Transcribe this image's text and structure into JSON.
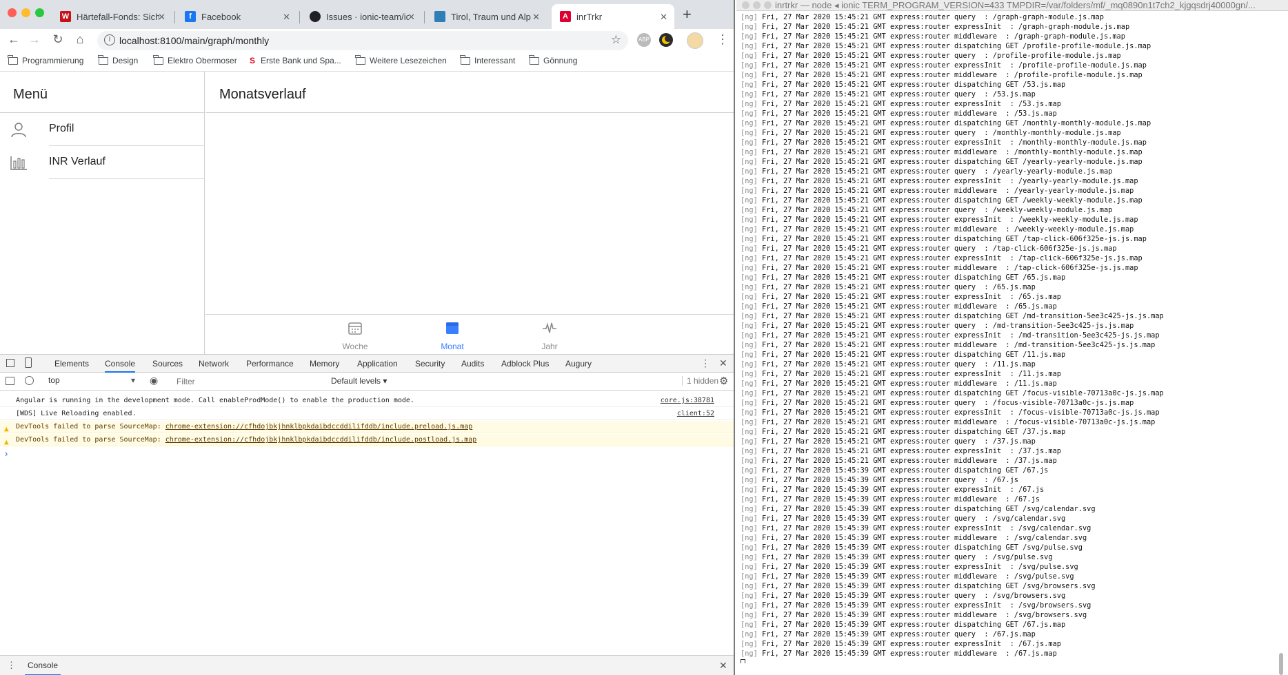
{
  "browser": {
    "tabs": [
      {
        "title": "Härtefall-Fonds: Siche",
        "favicon": "W",
        "favicon_bg": "#c4121a",
        "favicon_color": "#ffffff"
      },
      {
        "title": "Facebook",
        "favicon": "f",
        "favicon_bg": "#1877f2",
        "favicon_color": "#ffffff"
      },
      {
        "title": "Issues · ionic-team/io",
        "favicon": "github-icon",
        "favicon_bg": "#202124",
        "favicon_color": "#ffffff"
      },
      {
        "title": "Tirol, Traum und Alp",
        "favicon": "leaf-icon",
        "favicon_bg": "#2e7fb8",
        "favicon_color": "#ffffff"
      },
      {
        "title": "inrTrkr",
        "favicon": "A",
        "favicon_bg": "#dd0031",
        "favicon_color": "#ffffff"
      }
    ],
    "url": "localhost:8100/main/graph/monthly",
    "bookmarks": [
      "Programmierung",
      "Design",
      "Elektro Obermoser",
      "Erste Bank und Spa...",
      "Weitere Lesezeichen",
      "Interessant",
      "Gönnung"
    ],
    "ext_abp": "ABP"
  },
  "app": {
    "menu_title": "Menü",
    "menu_items": [
      {
        "label": "Profil",
        "icon": "person-icon"
      },
      {
        "label": "INR Verlauf",
        "icon": "bar-chart-icon"
      }
    ],
    "page_title": "Monatsverlauf",
    "tabs": [
      {
        "label": "Woche",
        "icon": "calendar-icon"
      },
      {
        "label": "Monat",
        "icon": "calendar-icon",
        "selected": true
      },
      {
        "label": "Jahr",
        "icon": "pulse-icon"
      }
    ],
    "accent": "#3880ff"
  },
  "devtools": {
    "tabs": [
      "Elements",
      "Console",
      "Sources",
      "Network",
      "Performance",
      "Memory",
      "Application",
      "Security",
      "Audits",
      "Adblock Plus",
      "Augury"
    ],
    "context": "top",
    "filter_placeholder": "Filter",
    "levels": "Default levels",
    "hidden": "1 hidden",
    "messages": [
      {
        "text": "Angular is running in the development mode. Call enableProdMode() to enable the production mode.",
        "source": "core.js:38781",
        "level": "info"
      },
      {
        "text": "[WDS] Live Reloading enabled.",
        "source": "client:52",
        "level": "info"
      },
      {
        "text": "DevTools failed to parse SourceMap: ",
        "link": "chrome-extension://cfhdojbkjhnklbpkdaibdccddilifddb/include.preload.js.map",
        "level": "warn"
      },
      {
        "text": "DevTools failed to parse SourceMap: ",
        "link": "chrome-extension://cfhdojbkjhnklbpkdaibdccddilifddb/include.postload.js.map",
        "level": "warn"
      }
    ],
    "prompt": "›",
    "drawer_tab": "Console"
  },
  "terminal": {
    "title": "inrtrkr — node ◂ ionic TERM_PROGRAM_VERSION=433 TMPDIR=/var/folders/mf/_mq0890n1t7ch2_kjgqsdrj40000gn/...",
    "prefix": "[ng]",
    "lines": [
      "Fri, 27 Mar 2020 15:45:21 GMT express:router query  : /graph-graph-module.js.map",
      "Fri, 27 Mar 2020 15:45:21 GMT express:router expressInit  : /graph-graph-module.js.map",
      "Fri, 27 Mar 2020 15:45:21 GMT express:router middleware  : /graph-graph-module.js.map",
      "Fri, 27 Mar 2020 15:45:21 GMT express:router dispatching GET /profile-profile-module.js.map",
      "Fri, 27 Mar 2020 15:45:21 GMT express:router query  : /profile-profile-module.js.map",
      "Fri, 27 Mar 2020 15:45:21 GMT express:router expressInit  : /profile-profile-module.js.map",
      "Fri, 27 Mar 2020 15:45:21 GMT express:router middleware  : /profile-profile-module.js.map",
      "Fri, 27 Mar 2020 15:45:21 GMT express:router dispatching GET /53.js.map",
      "Fri, 27 Mar 2020 15:45:21 GMT express:router query  : /53.js.map",
      "Fri, 27 Mar 2020 15:45:21 GMT express:router expressInit  : /53.js.map",
      "Fri, 27 Mar 2020 15:45:21 GMT express:router middleware  : /53.js.map",
      "Fri, 27 Mar 2020 15:45:21 GMT express:router dispatching GET /monthly-monthly-module.js.map",
      "Fri, 27 Mar 2020 15:45:21 GMT express:router query  : /monthly-monthly-module.js.map",
      "Fri, 27 Mar 2020 15:45:21 GMT express:router expressInit  : /monthly-monthly-module.js.map",
      "Fri, 27 Mar 2020 15:45:21 GMT express:router middleware  : /monthly-monthly-module.js.map",
      "Fri, 27 Mar 2020 15:45:21 GMT express:router dispatching GET /yearly-yearly-module.js.map",
      "Fri, 27 Mar 2020 15:45:21 GMT express:router query  : /yearly-yearly-module.js.map",
      "Fri, 27 Mar 2020 15:45:21 GMT express:router expressInit  : /yearly-yearly-module.js.map",
      "Fri, 27 Mar 2020 15:45:21 GMT express:router middleware  : /yearly-yearly-module.js.map",
      "Fri, 27 Mar 2020 15:45:21 GMT express:router dispatching GET /weekly-weekly-module.js.map",
      "Fri, 27 Mar 2020 15:45:21 GMT express:router query  : /weekly-weekly-module.js.map",
      "Fri, 27 Mar 2020 15:45:21 GMT express:router expressInit  : /weekly-weekly-module.js.map",
      "Fri, 27 Mar 2020 15:45:21 GMT express:router middleware  : /weekly-weekly-module.js.map",
      "Fri, 27 Mar 2020 15:45:21 GMT express:router dispatching GET /tap-click-606f325e-js.js.map",
      "Fri, 27 Mar 2020 15:45:21 GMT express:router query  : /tap-click-606f325e-js.js.map",
      "Fri, 27 Mar 2020 15:45:21 GMT express:router expressInit  : /tap-click-606f325e-js.js.map",
      "Fri, 27 Mar 2020 15:45:21 GMT express:router middleware  : /tap-click-606f325e-js.js.map",
      "Fri, 27 Mar 2020 15:45:21 GMT express:router dispatching GET /65.js.map",
      "Fri, 27 Mar 2020 15:45:21 GMT express:router query  : /65.js.map",
      "Fri, 27 Mar 2020 15:45:21 GMT express:router expressInit  : /65.js.map",
      "Fri, 27 Mar 2020 15:45:21 GMT express:router middleware  : /65.js.map",
      "Fri, 27 Mar 2020 15:45:21 GMT express:router dispatching GET /md-transition-5ee3c425-js.js.map",
      "Fri, 27 Mar 2020 15:45:21 GMT express:router query  : /md-transition-5ee3c425-js.js.map",
      "Fri, 27 Mar 2020 15:45:21 GMT express:router expressInit  : /md-transition-5ee3c425-js.js.map",
      "Fri, 27 Mar 2020 15:45:21 GMT express:router middleware  : /md-transition-5ee3c425-js.js.map",
      "Fri, 27 Mar 2020 15:45:21 GMT express:router dispatching GET /11.js.map",
      "Fri, 27 Mar 2020 15:45:21 GMT express:router query  : /11.js.map",
      "Fri, 27 Mar 2020 15:45:21 GMT express:router expressInit  : /11.js.map",
      "Fri, 27 Mar 2020 15:45:21 GMT express:router middleware  : /11.js.map",
      "Fri, 27 Mar 2020 15:45:21 GMT express:router dispatching GET /focus-visible-70713a0c-js.js.map",
      "Fri, 27 Mar 2020 15:45:21 GMT express:router query  : /focus-visible-70713a0c-js.js.map",
      "Fri, 27 Mar 2020 15:45:21 GMT express:router expressInit  : /focus-visible-70713a0c-js.js.map",
      "Fri, 27 Mar 2020 15:45:21 GMT express:router middleware  : /focus-visible-70713a0c-js.js.map",
      "Fri, 27 Mar 2020 15:45:21 GMT express:router dispatching GET /37.js.map",
      "Fri, 27 Mar 2020 15:45:21 GMT express:router query  : /37.js.map",
      "Fri, 27 Mar 2020 15:45:21 GMT express:router expressInit  : /37.js.map",
      "Fri, 27 Mar 2020 15:45:21 GMT express:router middleware  : /37.js.map",
      "Fri, 27 Mar 2020 15:45:39 GMT express:router dispatching GET /67.js",
      "Fri, 27 Mar 2020 15:45:39 GMT express:router query  : /67.js",
      "Fri, 27 Mar 2020 15:45:39 GMT express:router expressInit  : /67.js",
      "Fri, 27 Mar 2020 15:45:39 GMT express:router middleware  : /67.js",
      "Fri, 27 Mar 2020 15:45:39 GMT express:router dispatching GET /svg/calendar.svg",
      "Fri, 27 Mar 2020 15:45:39 GMT express:router query  : /svg/calendar.svg",
      "Fri, 27 Mar 2020 15:45:39 GMT express:router expressInit  : /svg/calendar.svg",
      "Fri, 27 Mar 2020 15:45:39 GMT express:router middleware  : /svg/calendar.svg",
      "Fri, 27 Mar 2020 15:45:39 GMT express:router dispatching GET /svg/pulse.svg",
      "Fri, 27 Mar 2020 15:45:39 GMT express:router query  : /svg/pulse.svg",
      "Fri, 27 Mar 2020 15:45:39 GMT express:router expressInit  : /svg/pulse.svg",
      "Fri, 27 Mar 2020 15:45:39 GMT express:router middleware  : /svg/pulse.svg",
      "Fri, 27 Mar 2020 15:45:39 GMT express:router dispatching GET /svg/browsers.svg",
      "Fri, 27 Mar 2020 15:45:39 GMT express:router query  : /svg/browsers.svg",
      "Fri, 27 Mar 2020 15:45:39 GMT express:router expressInit  : /svg/browsers.svg",
      "Fri, 27 Mar 2020 15:45:39 GMT express:router middleware  : /svg/browsers.svg",
      "Fri, 27 Mar 2020 15:45:39 GMT express:router dispatching GET /67.js.map",
      "Fri, 27 Mar 2020 15:45:39 GMT express:router query  : /67.js.map",
      "Fri, 27 Mar 2020 15:45:39 GMT express:router expressInit  : /67.js.map",
      "Fri, 27 Mar 2020 15:45:39 GMT express:router middleware  : /67.js.map"
    ]
  }
}
